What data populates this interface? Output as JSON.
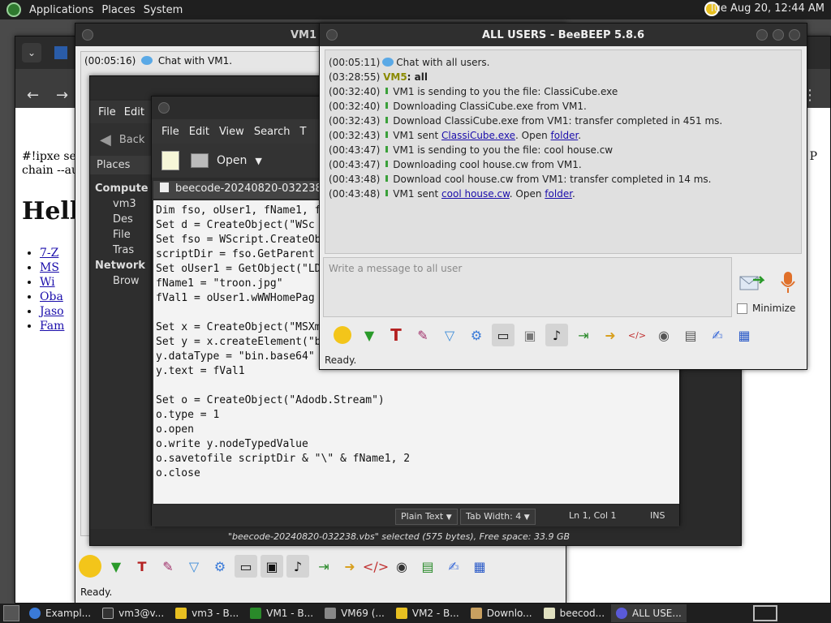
{
  "top_panel": {
    "menus": [
      "Applications",
      "Places",
      "System"
    ],
    "clock": "Tue Aug 20, 12:44 AM"
  },
  "browser": {
    "tab_title": "Example",
    "page_text": "#!ipxe set r",
    "page_text2": "chain --aut",
    "right_text": "P",
    "heading": "Hello",
    "links": [
      "7-Z",
      "MS",
      "Wi",
      "Oba",
      "Jaso",
      "Fam"
    ]
  },
  "vm1_window": {
    "title": "VM1 - Bee",
    "first_line": "(00:05:16)",
    "first_text": "Chat with VM1.",
    "status": "Ready."
  },
  "file_manager": {
    "title": "beecode",
    "menus": [
      "File",
      "Edit"
    ],
    "back_label": "Back",
    "places_label": "Places",
    "sidebar": [
      "Compute",
      "vm3",
      "Des",
      "File",
      "Tras",
      "Network",
      "Brow"
    ],
    "status": "\"beecode-20240820-032238.vbs\" selected (575 bytes), Free space: 33.9 GB"
  },
  "editor": {
    "menus": [
      "File",
      "Edit",
      "View",
      "Search",
      "T"
    ],
    "open_label": "Open",
    "tab": "beecode-20240820-032238.vbs",
    "code": "Dim fso, oUser1, fName1, fVa\nSet d = CreateObject(\"WSc\nSet fso = WScript.CreateOb\nscriptDir = fso.GetParent\nSet oUser1 = GetObject(\"LD\nfName1 = \"troon.jpg\"\nfVal1 = oUser1.wWWHomePag\n\nSet x = CreateObject(\"MSXm\nSet y = x.createElement(\"b\ny.dataType = \"bin.base64\"\ny.text = fVal1\n\nSet o = CreateObject(\"Adodb.Stream\")\no.type = 1\no.open\no.write y.nodeTypedValue\no.savetofile scriptDir & \"\\\" & fName1, 2\no.close",
    "syntax": "Plain Text",
    "tab_width": "Tab Width:  4",
    "position": "Ln 1, Col 1",
    "mode": "INS"
  },
  "beebeep": {
    "title": "ALL USERS - BeeBEEP 5.8.6",
    "log": [
      {
        "ts": "(00:05:11)",
        "icon": "bubble",
        "text": "Chat with all users."
      },
      {
        "ts": "(03:28:55)",
        "icon": "none",
        "user": "VM5",
        "text": ": all"
      },
      {
        "ts": "(00:32:40)",
        "icon": "download",
        "text": "VM1 is sending to you the file: ClassiCube.exe"
      },
      {
        "ts": "(00:32:40)",
        "icon": "download",
        "text": "Downloading ClassiCube.exe from VM1."
      },
      {
        "ts": "(00:32:43)",
        "icon": "download",
        "text": "Download ClassiCube.exe from VM1: transfer completed in 451 ms."
      },
      {
        "ts": "(00:32:43)",
        "icon": "download",
        "pre": "VM1 sent ",
        "link": "ClassiCube.exe",
        "mid": ". Open ",
        "link2": "folder",
        "post": "."
      },
      {
        "ts": "(00:43:47)",
        "icon": "download",
        "text": "VM1 is sending to you the file: cool house.cw"
      },
      {
        "ts": "(00:43:47)",
        "icon": "download",
        "text": "Downloading cool house.cw from VM1."
      },
      {
        "ts": "(00:43:48)",
        "icon": "download",
        "text": "Download cool house.cw from VM1: transfer completed in 14 ms."
      },
      {
        "ts": "(00:43:48)",
        "icon": "download",
        "pre": "VM1 sent ",
        "link": "cool house.cw",
        "mid": ". Open ",
        "link2": "folder",
        "post": "."
      }
    ],
    "input_placeholder": "Write a message to all user",
    "minimize_label": "Minimize",
    "status": "Ready.",
    "accent_user_color": "#8a8a00"
  },
  "taskbar": {
    "items": [
      "Exampl...",
      "vm3@v...",
      "vm3 - B...",
      "VM1 - B...",
      "VM69 (...",
      "VM2 - B...",
      "Downlo...",
      "beecod...",
      "ALL USE..."
    ]
  }
}
